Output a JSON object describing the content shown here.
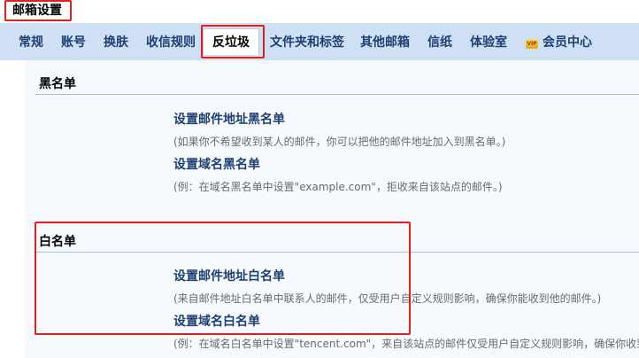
{
  "page": {
    "title": "邮箱设置"
  },
  "tabs": [
    {
      "label": "常规"
    },
    {
      "label": "账号"
    },
    {
      "label": "换肤"
    },
    {
      "label": "收信规则"
    },
    {
      "label": "反垃圾",
      "active": true
    },
    {
      "label": "文件夹和标签"
    },
    {
      "label": "其他邮箱"
    },
    {
      "label": "信纸"
    },
    {
      "label": "体验室"
    },
    {
      "label": "会员中心",
      "icon": "vip-icon",
      "icon_text": "VIP"
    }
  ],
  "blacklist": {
    "title": "黑名单",
    "address_link": "设置邮件地址黑名单",
    "address_desc": "(如果你不希望收到某人的邮件，你可以把他的邮件地址加入到黑名单。)",
    "domain_link": "设置域名黑名单",
    "domain_desc": "(例：在域名黑名单中设置\"example.com\"，拒收来自该站点的邮件。)"
  },
  "whitelist": {
    "title": "白名单",
    "address_link": "设置邮件地址白名单",
    "address_desc": "(来自邮件地址白名单中联系人的邮件，仅受用户自定义规则影响，确保你能收到他的邮件。)",
    "domain_link": "设置域名白名单",
    "domain_desc": "(例：在域名白名单中设置\"tencent.com\"，来自该站点的邮件仅受用户自定义规则影响，确保你收到"
  },
  "colors": {
    "accent": "#1d3f72",
    "tabbar": "#cfe0f5",
    "highlight": "#e0201c"
  }
}
